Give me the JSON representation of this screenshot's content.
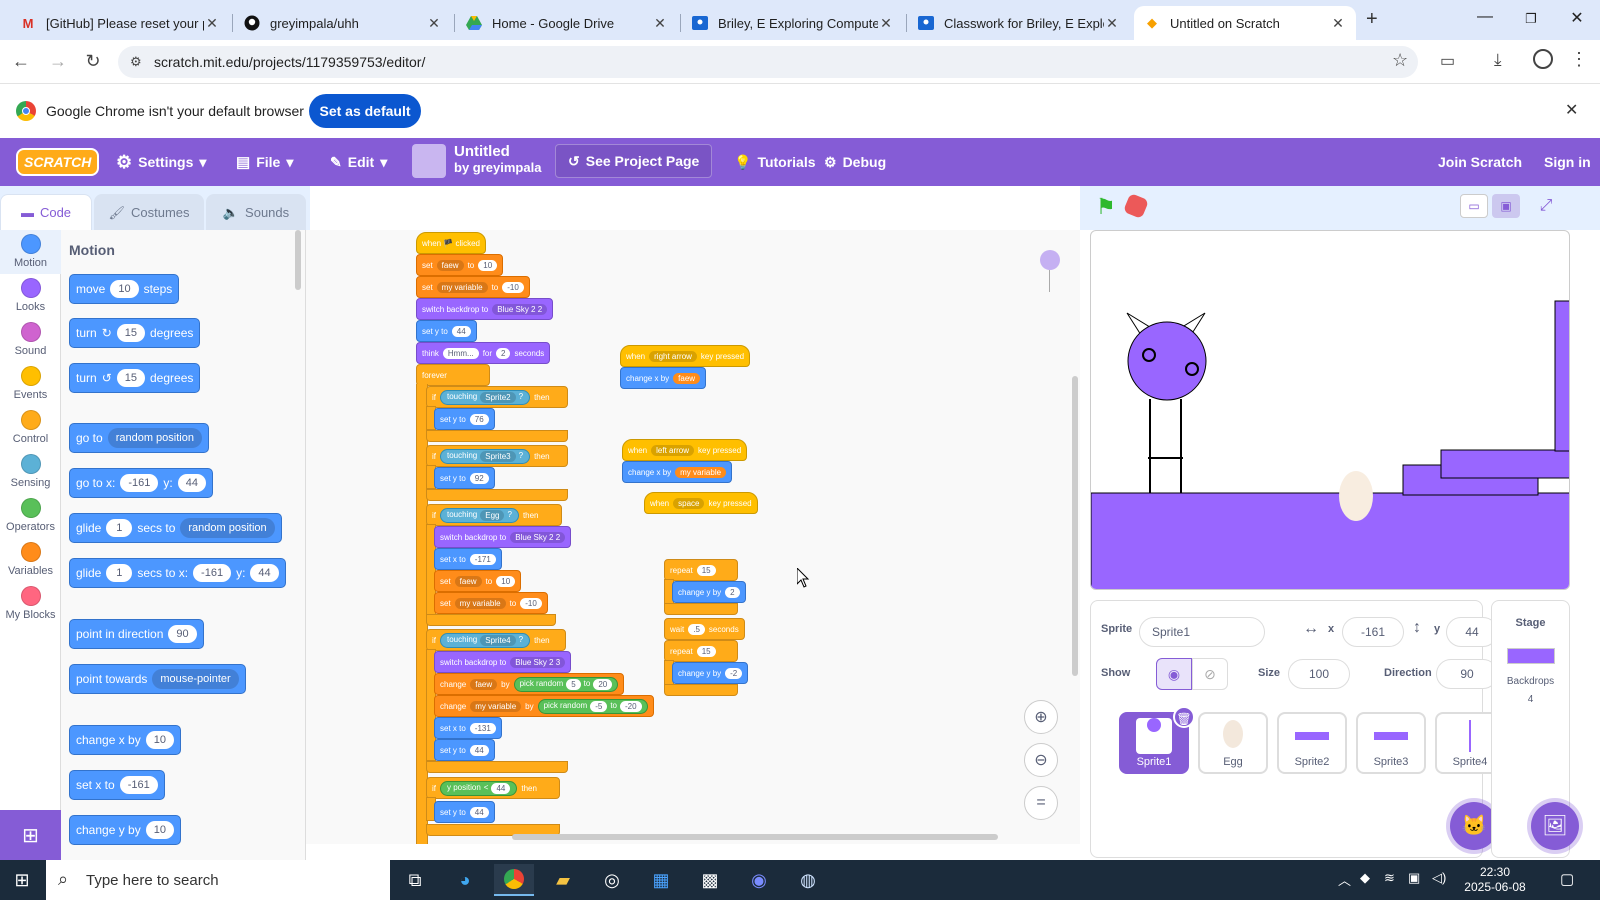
{
  "browser": {
    "tabs": [
      {
        "title": "[GitHub] Please reset your pa",
        "icon": "gmail-icon"
      },
      {
        "title": "greyimpala/uhh",
        "icon": "github-icon"
      },
      {
        "title": "Home - Google Drive",
        "icon": "drive-icon"
      },
      {
        "title": "Briley, E Exploring Computer",
        "icon": "classroom-icon"
      },
      {
        "title": "Classwork for Briley, E Explori",
        "icon": "classroom-icon"
      },
      {
        "title": "Untitled on Scratch",
        "icon": "scratch-icon"
      }
    ],
    "url": "scratch.mit.edu/projects/1179359753/editor/",
    "infobar_text": "Google Chrome isn't your default browser",
    "infobar_button": "Set as default"
  },
  "menu": {
    "logo": "SCRATCH",
    "settings": "Settings",
    "file": "File",
    "edit": "Edit",
    "project_title": "Untitled",
    "project_author": "by greyimpala",
    "see_project": "See Project Page",
    "tutorials": "Tutorials",
    "debug": "Debug",
    "join": "Join Scratch",
    "signin": "Sign in"
  },
  "editor_tabs": {
    "code": "Code",
    "costumes": "Costumes",
    "sounds": "Sounds"
  },
  "categories": [
    {
      "label": "Motion",
      "color": "#4c97ff"
    },
    {
      "label": "Looks",
      "color": "#9966ff"
    },
    {
      "label": "Sound",
      "color": "#cf63cf"
    },
    {
      "label": "Events",
      "color": "#ffbf00"
    },
    {
      "label": "Control",
      "color": "#ffab19"
    },
    {
      "label": "Sensing",
      "color": "#5cb1d6"
    },
    {
      "label": "Operators",
      "color": "#59c059"
    },
    {
      "label": "Variables",
      "color": "#ff8c1a"
    },
    {
      "label": "My Blocks",
      "color": "#ff6680"
    }
  ],
  "palette": {
    "heading": "Motion",
    "move": {
      "a": "move",
      "v": "10",
      "b": "steps"
    },
    "turn_cw": {
      "a": "turn",
      "v": "15",
      "b": "degrees"
    },
    "turn_ccw": {
      "a": "turn",
      "v": "15",
      "b": "degrees"
    },
    "goto": {
      "a": "go to",
      "d": "random position"
    },
    "gotoxy": {
      "a": "go to x:",
      "x": "-161",
      "b": "y:",
      "y": "44"
    },
    "glide1": {
      "a": "glide",
      "v": "1",
      "b": "secs to",
      "d": "random position"
    },
    "glide2": {
      "a": "glide",
      "v": "1",
      "b": "secs to x:",
      "x": "-161",
      "c": "y:",
      "y": "44"
    },
    "point_dir": {
      "a": "point in direction",
      "v": "90"
    },
    "point_towards": {
      "a": "point towards",
      "d": "mouse-pointer"
    },
    "change_x": {
      "a": "change x by",
      "v": "10"
    },
    "set_x": {
      "a": "set x to",
      "v": "-161"
    },
    "change_y": {
      "a": "change y by",
      "v": "10"
    }
  },
  "script": {
    "when_flag": "when 🏴 clicked",
    "set": "set",
    "to": "to",
    "faew": "faew",
    "myvar": "my variable",
    "v10": "10",
    "vneg10": "-10",
    "switch_backdrop": "switch backdrop to",
    "blue22": "Blue Sky 2 2",
    "blue23": "Blue Sky 2 3",
    "set_y_to": "set y to",
    "v44": "44",
    "think": "think",
    "hmm": "Hmm...",
    "for": "for",
    "v2": "2",
    "seconds": "seconds",
    "forever": "forever",
    "if": "if",
    "touching": "touching",
    "then": "then",
    "q": "?",
    "sprite2": "Sprite2",
    "sprite3": "Sprite3",
    "egg": "Egg",
    "sprite4": "Sprite4",
    "v76": "76",
    "v92": "92",
    "set_x_to": "set x to",
    "vneg171": "-171",
    "change": "change",
    "by": "by",
    "pick_random": "pick random",
    "v5": "5",
    "v20": "20",
    "vneg5": "-5",
    "vneg20": "-20",
    "vneg131": "-131",
    "y_position": "y position",
    "lt": "<",
    "when": "when",
    "right_arrow": "right arrow",
    "left_arrow": "left arrow",
    "space": "space",
    "key_pressed": "key pressed",
    "change_x_by": "change x by",
    "repeat": "repeat",
    "v15": "15",
    "change_y_by": "change y by",
    "vneg2": "-2",
    "wait": "wait",
    "v05": ".5"
  },
  "sprite_info": {
    "sprite_label": "Sprite",
    "sprite_name": "Sprite1",
    "x_label": "x",
    "x": "-161",
    "y_label": "y",
    "y": "44",
    "show_label": "Show",
    "size_label": "Size",
    "size": "100",
    "direction_label": "Direction",
    "direction": "90"
  },
  "sprites": [
    "Sprite1",
    "Egg",
    "Sprite2",
    "Sprite3",
    "Sprite4"
  ],
  "stage_panel": {
    "title": "Stage",
    "backdrops_label": "Backdrops",
    "backdrops_count": "4"
  },
  "taskbar": {
    "search": "Type here to search",
    "time": "22:30",
    "date": "2025-06-08"
  },
  "colors": {
    "scratch_purple": "#855cd6",
    "motion": "#4c97ff",
    "chrome_blue": "#0b57d0"
  }
}
